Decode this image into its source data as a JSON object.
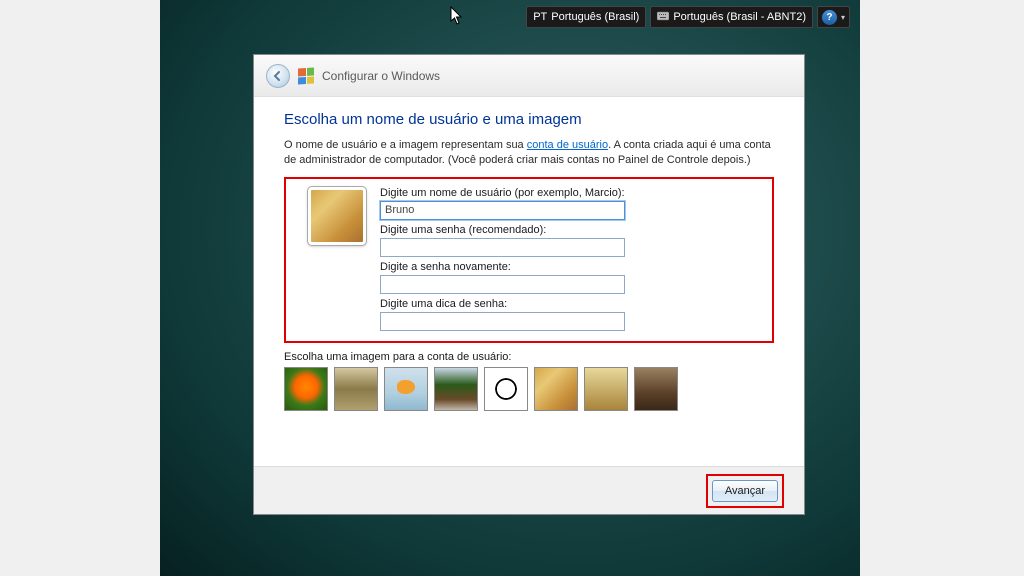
{
  "taskbar": {
    "lang_code": "PT",
    "lang_label": "Português (Brasil)",
    "keyboard_label": "Português (Brasil - ABNT2)"
  },
  "wizard": {
    "title": "Configurar o Windows",
    "heading": "Escolha um nome de usuário e uma imagem",
    "intro_pre": "O nome de usuário e a imagem representam sua ",
    "intro_link": "conta de usuário",
    "intro_post": ". A conta criada aqui é uma conta de administrador de computador. (Você poderá criar mais contas no Painel de Controle depois.)",
    "fields": {
      "username_label": "Digite um nome de usuário (por exemplo, Marcio):",
      "username_value": "Bruno",
      "password_label": "Digite uma senha (recomendado):",
      "password_value": "",
      "confirm_label": "Digite a senha novamente:",
      "confirm_value": "",
      "hint_label": "Digite uma dica de senha:",
      "hint_value": ""
    },
    "pick_label": "Escolha uma imagem para a conta de usuário:",
    "thumbs": [
      "flower",
      "robot",
      "fish",
      "bonsai",
      "ball",
      "puppy",
      "chess",
      "cat"
    ],
    "next_label": "Avançar"
  }
}
